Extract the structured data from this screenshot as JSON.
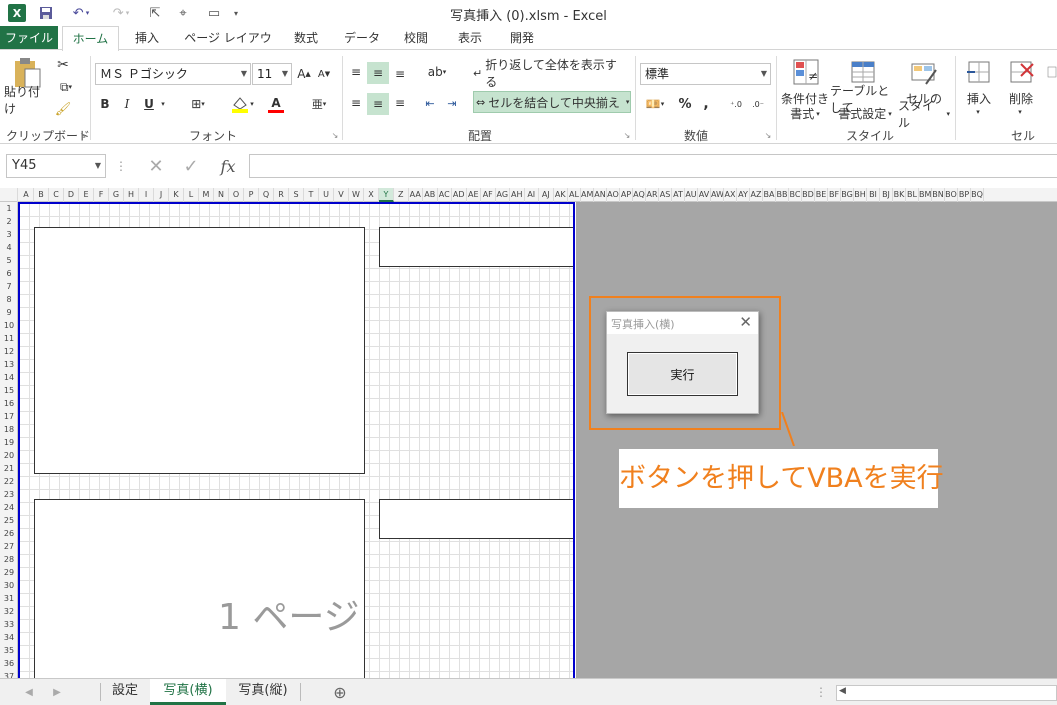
{
  "window": {
    "title": "写真挿入 (0).xlsm - Excel"
  },
  "ribbon_tabs": [
    "ファイル",
    "ホーム",
    "挿入",
    "ページ レイアウト",
    "数式",
    "データ",
    "校閲",
    "表示",
    "開発"
  ],
  "ribbon": {
    "paste_label": "貼り付け",
    "clipboard_group": "クリップボード",
    "font_name": "ＭＳ Ｐゴシック",
    "font_size": "11",
    "font_group": "フォント",
    "wrap_text": "折り返して全体を表示する",
    "merge_center": "セルを結合して中央揃え",
    "alignment_group": "配置",
    "number_format": "標準",
    "number_group": "数値",
    "cond_format_1": "条件付き",
    "cond_format_2": "書式",
    "table_format_1": "テーブルとして",
    "table_format_2": "書式設定",
    "cell_style_1": "セルの",
    "cell_style_2": "スタイル",
    "styles_group": "スタイル",
    "insert_label": "挿入",
    "delete_label": "削除",
    "cells_group": "セル",
    "percent": "%",
    "comma": ",",
    "bold": "B",
    "italic": "I",
    "underline": "U",
    "font_color_letter": "A"
  },
  "formula_bar": {
    "name_box": "Y45",
    "fx": "fx",
    "formula": ""
  },
  "columns": [
    "A",
    "B",
    "C",
    "D",
    "E",
    "F",
    "G",
    "H",
    "I",
    "J",
    "K",
    "L",
    "M",
    "N",
    "O",
    "P",
    "Q",
    "R",
    "S",
    "T",
    "U",
    "V",
    "W",
    "X",
    "Y",
    "Z",
    "AA",
    "AB",
    "AC",
    "AD",
    "AE",
    "AF",
    "AG",
    "AH",
    "AI",
    "AJ",
    "AK",
    "AL",
    "AM",
    "AN",
    "AO",
    "AP",
    "AQ",
    "AR",
    "AS",
    "AT",
    "AU",
    "AV",
    "AW",
    "AX",
    "AY",
    "AZ",
    "BA",
    "BB",
    "BC",
    "BD",
    "BE",
    "BF",
    "BG",
    "BH",
    "BI",
    "BJ",
    "BK",
    "BL",
    "BM",
    "BN",
    "BO",
    "BP",
    "BQ"
  ],
  "rows": [
    "1",
    "2",
    "3",
    "4",
    "5",
    "6",
    "7",
    "8",
    "9",
    "10",
    "11",
    "12",
    "13",
    "14",
    "15",
    "16",
    "17",
    "18",
    "19",
    "20",
    "21",
    "22",
    "23",
    "24",
    "25",
    "26",
    "27",
    "28",
    "29",
    "30",
    "31",
    "32",
    "33",
    "34",
    "35",
    "36",
    "37"
  ],
  "page_watermark": "1 ページ",
  "dialog": {
    "title": "写真挿入(横)",
    "run_button": "実行"
  },
  "callout": "ボタンを押してVBAを実行",
  "sheet_tabs": [
    "設定",
    "写真(横)",
    "写真(縦)"
  ],
  "active_sheet": "写真(横)",
  "colors": {
    "excel_green": "#217346",
    "callout_orange": "#f0801e",
    "print_border": "#0000cc"
  }
}
